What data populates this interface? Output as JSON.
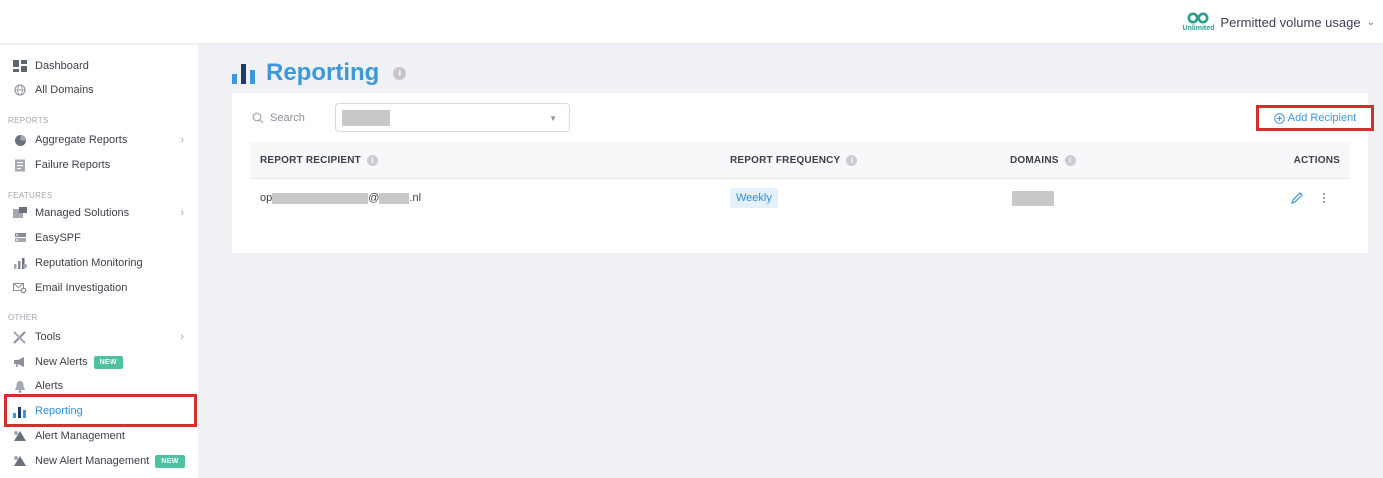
{
  "topbar": {
    "volume_badge": "Unlimited",
    "volume_label": "Permitted volume usage"
  },
  "sidebar": {
    "items_top": [
      {
        "label": "Dashboard",
        "icon": "dashboard-icon"
      },
      {
        "label": "All Domains",
        "icon": "globe-icon"
      }
    ],
    "sections": {
      "reports": "REPORTS",
      "features": "FEATURES",
      "other": "OTHER"
    },
    "reports_items": [
      {
        "label": "Aggregate Reports",
        "icon": "pie-chart-icon",
        "has_submenu": true
      },
      {
        "label": "Failure Reports",
        "icon": "report-icon"
      }
    ],
    "features_items": [
      {
        "label": "Managed Solutions",
        "icon": "managed-icon",
        "has_submenu": true
      },
      {
        "label": "EasySPF",
        "icon": "server-icon"
      },
      {
        "label": "Reputation Monitoring",
        "icon": "reputation-icon"
      },
      {
        "label": "Email Investigation",
        "icon": "email-investigation-icon"
      }
    ],
    "other_items": [
      {
        "label": "Tools",
        "icon": "tools-icon",
        "has_submenu": true
      },
      {
        "label": "New Alerts",
        "icon": "megaphone-icon",
        "badge": "NEW"
      },
      {
        "label": "Alerts",
        "icon": "bell-icon"
      },
      {
        "label": "Reporting",
        "icon": "bar-chart-icon",
        "active": true
      },
      {
        "label": "Alert Management",
        "icon": "alert-management-icon"
      },
      {
        "label": "New Alert Management",
        "icon": "alert-management-icon",
        "badge": "NEW"
      }
    ],
    "chevron": "›"
  },
  "page": {
    "title": "Reporting",
    "title_info": "i"
  },
  "toolbar": {
    "search_placeholder": "Search",
    "add_recipient_label": "Add Recipient"
  },
  "table": {
    "headers": [
      "REPORT RECIPIENT",
      "REPORT FREQUENCY",
      "DOMAINS",
      "ACTIONS"
    ],
    "rows": [
      {
        "recipient_prefix": "op",
        "recipient_at": "@",
        "recipient_suffix": ".nl",
        "frequency": "Weekly"
      }
    ]
  },
  "colors": {
    "accent": "#3d97d9",
    "highlight": "#d22f2f",
    "badge_new": "#4cc2a1",
    "unlimited": "#2a9d8f"
  }
}
